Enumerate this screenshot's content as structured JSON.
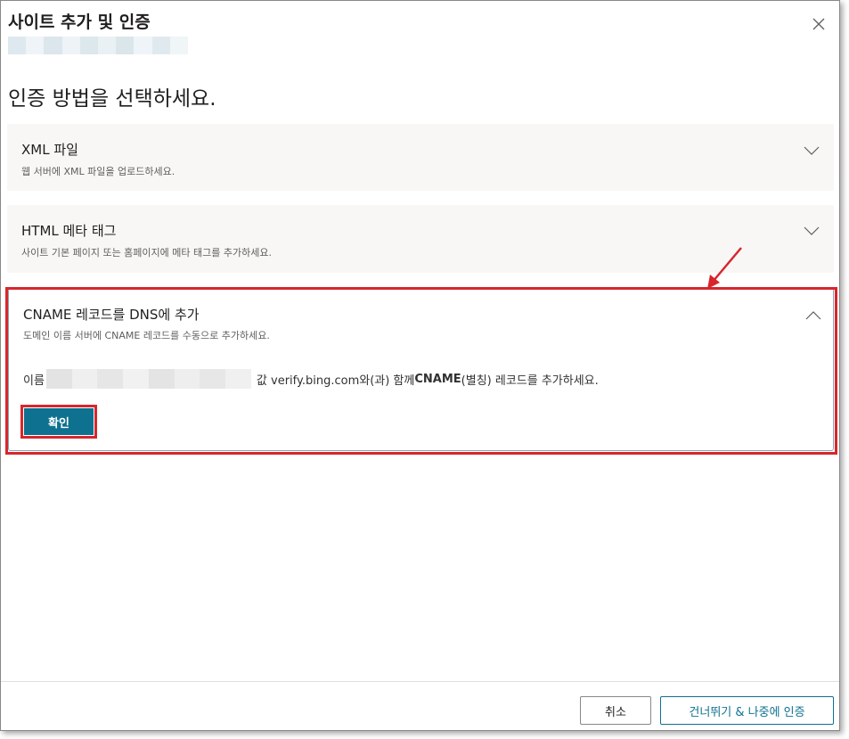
{
  "dialog": {
    "title": "사이트 추가 및 인증",
    "heading": "인증 방법을 선택하세요."
  },
  "methods": [
    {
      "title": "XML 파일",
      "description": "웹 서버에 XML 파일을 업로드하세요."
    },
    {
      "title": "HTML 메타 태그",
      "description": "사이트 기본 페이지 또는 홈페이지에 메타 태그를 추가하세요."
    }
  ],
  "cname": {
    "title": "CNAME 레코드를 DNS에 추가",
    "description": "도메인 이름 서버에 CNAME 레코드를 수동으로 추가하세요.",
    "name_label": "이름",
    "value_text": "값 verify.bing.com와(과) 함께 ",
    "record_type": "CNAME",
    "record_suffix": "(별칭) 레코드를 추가하세요.",
    "confirm_label": "확인"
  },
  "footer": {
    "cancel_label": "취소",
    "skip_label": "건너뛰기 & 나중에 인증"
  },
  "colors": {
    "accent": "#0e7190",
    "highlight": "#d7262c",
    "panel_bg": "#f8f7f6"
  },
  "icons": [
    "close-icon",
    "chevron-down-icon",
    "chevron-up-icon",
    "arrow-annotation-icon"
  ]
}
